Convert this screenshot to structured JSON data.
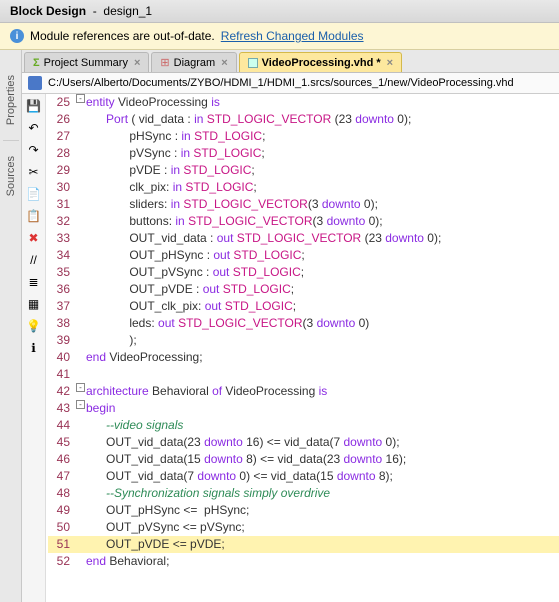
{
  "titlebar": {
    "label": "Block Design",
    "name": "design_1"
  },
  "notify": {
    "message": "Module references are out-of-date.",
    "link": "Refresh Changed Modules"
  },
  "sidetabs": {
    "properties": "Properties",
    "sources": "Sources"
  },
  "tabs": {
    "summary": "Project Summary",
    "diagram": "Diagram",
    "file": "VideoProcessing.vhd *"
  },
  "path": "C:/Users/Alberto/Documents/ZYBO/HDMI_1/HDMI_1.srcs/sources_1/new/VideoProcessing.vhd",
  "tool_icons": {
    "save": "💾",
    "undo": "↶",
    "redo": "↷",
    "cut": "✂",
    "copy": "📄",
    "paste": "📋",
    "delete": "✖",
    "find": "//",
    "collapse": "≣",
    "expand": "▦",
    "bulb": "💡",
    "help": "ℹ"
  },
  "code": [
    {
      "n": 25,
      "fold": "-",
      "tokens": [
        [
          "kw",
          "entity"
        ],
        [
          "pn",
          " VideoProcessing "
        ],
        [
          "kw",
          "is"
        ]
      ]
    },
    {
      "n": 26,
      "tokens": [
        [
          "pn",
          "      "
        ],
        [
          "kw",
          "Port"
        ],
        [
          "pn",
          " ( vid_data : "
        ],
        [
          "kw",
          "in"
        ],
        [
          "pn",
          " "
        ],
        [
          "ty",
          "STD_LOGIC_VECTOR"
        ],
        [
          "pn",
          " (23 "
        ],
        [
          "kw",
          "downto"
        ],
        [
          "pn",
          " 0);"
        ]
      ]
    },
    {
      "n": 27,
      "tokens": [
        [
          "pn",
          "             pHSync : "
        ],
        [
          "kw",
          "in"
        ],
        [
          "pn",
          " "
        ],
        [
          "ty",
          "STD_LOGIC"
        ],
        [
          "pn",
          ";"
        ]
      ]
    },
    {
      "n": 28,
      "tokens": [
        [
          "pn",
          "             pVSync : "
        ],
        [
          "kw",
          "in"
        ],
        [
          "pn",
          " "
        ],
        [
          "ty",
          "STD_LOGIC"
        ],
        [
          "pn",
          ";"
        ]
      ]
    },
    {
      "n": 29,
      "tokens": [
        [
          "pn",
          "             pVDE : "
        ],
        [
          "kw",
          "in"
        ],
        [
          "pn",
          " "
        ],
        [
          "ty",
          "STD_LOGIC"
        ],
        [
          "pn",
          ";"
        ]
      ]
    },
    {
      "n": 30,
      "tokens": [
        [
          "pn",
          "             clk_pix: "
        ],
        [
          "kw",
          "in"
        ],
        [
          "pn",
          " "
        ],
        [
          "ty",
          "STD_LOGIC"
        ],
        [
          "pn",
          ";"
        ]
      ]
    },
    {
      "n": 31,
      "tokens": [
        [
          "pn",
          "             sliders: "
        ],
        [
          "kw",
          "in"
        ],
        [
          "pn",
          " "
        ],
        [
          "ty",
          "STD_LOGIC_VECTOR"
        ],
        [
          "pn",
          "(3 "
        ],
        [
          "kw",
          "downto"
        ],
        [
          "pn",
          " 0);"
        ]
      ]
    },
    {
      "n": 32,
      "tokens": [
        [
          "pn",
          "             buttons: "
        ],
        [
          "kw",
          "in"
        ],
        [
          "pn",
          " "
        ],
        [
          "ty",
          "STD_LOGIC_VECTOR"
        ],
        [
          "pn",
          "(3 "
        ],
        [
          "kw",
          "downto"
        ],
        [
          "pn",
          " 0);"
        ]
      ]
    },
    {
      "n": 33,
      "tokens": [
        [
          "pn",
          "             OUT_vid_data : "
        ],
        [
          "kw",
          "out"
        ],
        [
          "pn",
          " "
        ],
        [
          "ty",
          "STD_LOGIC_VECTOR"
        ],
        [
          "pn",
          " (23 "
        ],
        [
          "kw",
          "downto"
        ],
        [
          "pn",
          " 0);"
        ]
      ]
    },
    {
      "n": 34,
      "tokens": [
        [
          "pn",
          "             OUT_pHSync : "
        ],
        [
          "kw",
          "out"
        ],
        [
          "pn",
          " "
        ],
        [
          "ty",
          "STD_LOGIC"
        ],
        [
          "pn",
          ";"
        ]
      ]
    },
    {
      "n": 35,
      "tokens": [
        [
          "pn",
          "             OUT_pVSync : "
        ],
        [
          "kw",
          "out"
        ],
        [
          "pn",
          " "
        ],
        [
          "ty",
          "STD_LOGIC"
        ],
        [
          "pn",
          ";"
        ]
      ]
    },
    {
      "n": 36,
      "tokens": [
        [
          "pn",
          "             OUT_pVDE : "
        ],
        [
          "kw",
          "out"
        ],
        [
          "pn",
          " "
        ],
        [
          "ty",
          "STD_LOGIC"
        ],
        [
          "pn",
          ";"
        ]
      ]
    },
    {
      "n": 37,
      "tokens": [
        [
          "pn",
          "             OUT_clk_pix: "
        ],
        [
          "kw",
          "out"
        ],
        [
          "pn",
          " "
        ],
        [
          "ty",
          "STD_LOGIC"
        ],
        [
          "pn",
          ";"
        ]
      ]
    },
    {
      "n": 38,
      "tokens": [
        [
          "pn",
          "             leds: "
        ],
        [
          "kw",
          "out"
        ],
        [
          "pn",
          " "
        ],
        [
          "ty",
          "STD_LOGIC_VECTOR"
        ],
        [
          "pn",
          "(3 "
        ],
        [
          "kw",
          "downto"
        ],
        [
          "pn",
          " 0)"
        ]
      ]
    },
    {
      "n": 39,
      "tokens": [
        [
          "pn",
          "             );"
        ]
      ]
    },
    {
      "n": 40,
      "tokens": [
        [
          "kw",
          "end"
        ],
        [
          "pn",
          " VideoProcessing;"
        ]
      ]
    },
    {
      "n": 41,
      "tokens": [
        [
          "pn",
          ""
        ]
      ]
    },
    {
      "n": 42,
      "fold": "-",
      "tokens": [
        [
          "kw",
          "architecture"
        ],
        [
          "pn",
          " Behavioral "
        ],
        [
          "kw",
          "of"
        ],
        [
          "pn",
          " VideoProcessing "
        ],
        [
          "kw",
          "is"
        ]
      ]
    },
    {
      "n": 43,
      "fold": "-",
      "tokens": [
        [
          "kw",
          "begin"
        ]
      ]
    },
    {
      "n": 44,
      "tokens": [
        [
          "pn",
          "      "
        ],
        [
          "cm",
          "--video signals"
        ]
      ]
    },
    {
      "n": 45,
      "tokens": [
        [
          "pn",
          "      OUT_vid_data(23 "
        ],
        [
          "kw",
          "downto"
        ],
        [
          "pn",
          " 16) <= vid_data(7 "
        ],
        [
          "kw",
          "downto"
        ],
        [
          "pn",
          " 0);"
        ]
      ]
    },
    {
      "n": 46,
      "tokens": [
        [
          "pn",
          "      OUT_vid_data(15 "
        ],
        [
          "kw",
          "downto"
        ],
        [
          "pn",
          " 8) <= vid_data(23 "
        ],
        [
          "kw",
          "downto"
        ],
        [
          "pn",
          " 16);"
        ]
      ]
    },
    {
      "n": 47,
      "tokens": [
        [
          "pn",
          "      OUT_vid_data(7 "
        ],
        [
          "kw",
          "downto"
        ],
        [
          "pn",
          " 0) <= vid_data(15 "
        ],
        [
          "kw",
          "downto"
        ],
        [
          "pn",
          " 8);"
        ]
      ]
    },
    {
      "n": 48,
      "tokens": [
        [
          "pn",
          "      "
        ],
        [
          "cm",
          "--Synchronization signals simply overdrive"
        ]
      ]
    },
    {
      "n": 49,
      "tokens": [
        [
          "pn",
          "      OUT_pHSync <=  pHSync;"
        ]
      ]
    },
    {
      "n": 50,
      "tokens": [
        [
          "pn",
          "      OUT_pVSync <= pVSync;"
        ]
      ]
    },
    {
      "n": 51,
      "sel": true,
      "tokens": [
        [
          "pn",
          "      OUT_pVDE <= pVDE;"
        ]
      ]
    },
    {
      "n": 52,
      "tokens": [
        [
          "kw",
          "end"
        ],
        [
          "pn",
          " Behavioral;"
        ]
      ]
    }
  ]
}
